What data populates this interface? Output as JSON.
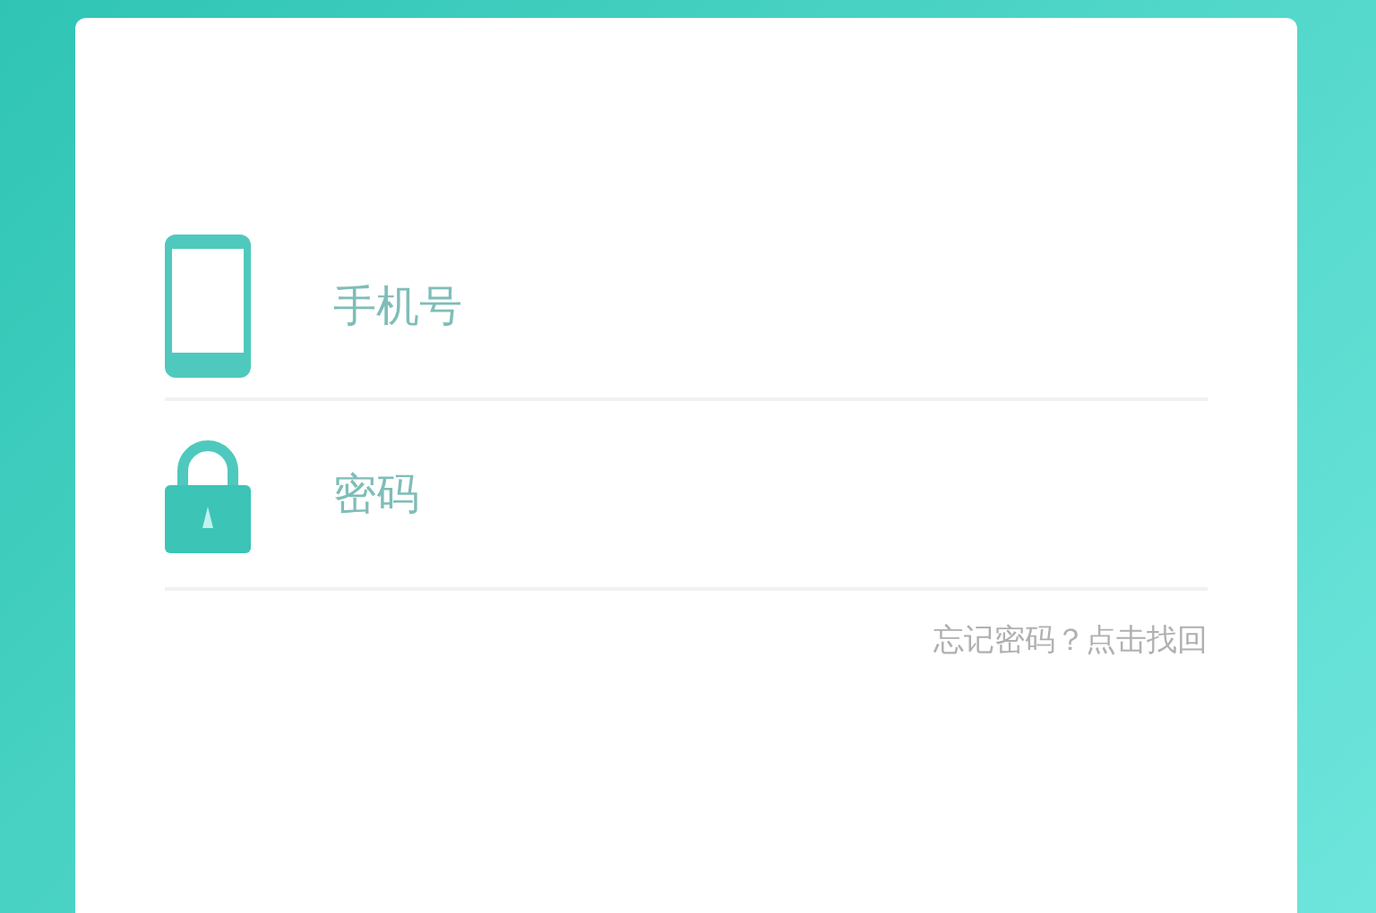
{
  "login_form": {
    "fields": [
      {
        "kind": "phone",
        "placeholder": "手机号"
      },
      {
        "kind": "password",
        "placeholder": "密码"
      }
    ],
    "forgot_link": "忘记密码？点击找回"
  }
}
